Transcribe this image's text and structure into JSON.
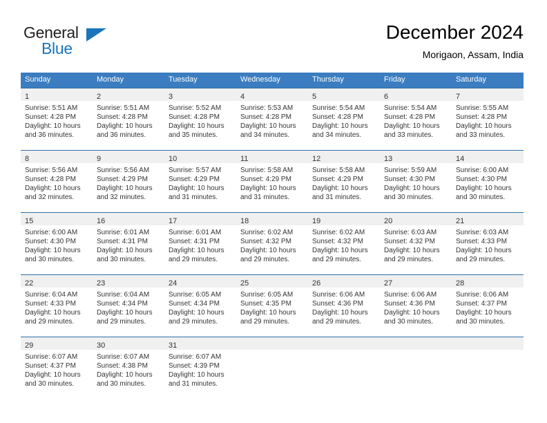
{
  "brand": {
    "name_top": "General",
    "name_bottom": "Blue",
    "color_dark": "#231f20",
    "color_blue": "#1b75bb"
  },
  "header": {
    "title": "December 2024",
    "subtitle": "Morigaon, Assam, India"
  },
  "theme": {
    "header_row_bg": "#3b7dc0",
    "header_row_text": "#ffffff",
    "daynum_band_bg": "#f0f0f0",
    "row_rule": "#2e6da4",
    "body_text": "#333333"
  },
  "calendar": {
    "weekday_headers": [
      "Sunday",
      "Monday",
      "Tuesday",
      "Wednesday",
      "Thursday",
      "Friday",
      "Saturday"
    ],
    "weeks": [
      [
        {
          "day": "1",
          "sunrise": "Sunrise: 5:51 AM",
          "sunset": "Sunset: 4:28 PM",
          "daylight_line1": "Daylight: 10 hours",
          "daylight_line2": "and 36 minutes."
        },
        {
          "day": "2",
          "sunrise": "Sunrise: 5:51 AM",
          "sunset": "Sunset: 4:28 PM",
          "daylight_line1": "Daylight: 10 hours",
          "daylight_line2": "and 36 minutes."
        },
        {
          "day": "3",
          "sunrise": "Sunrise: 5:52 AM",
          "sunset": "Sunset: 4:28 PM",
          "daylight_line1": "Daylight: 10 hours",
          "daylight_line2": "and 35 minutes."
        },
        {
          "day": "4",
          "sunrise": "Sunrise: 5:53 AM",
          "sunset": "Sunset: 4:28 PM",
          "daylight_line1": "Daylight: 10 hours",
          "daylight_line2": "and 34 minutes."
        },
        {
          "day": "5",
          "sunrise": "Sunrise: 5:54 AM",
          "sunset": "Sunset: 4:28 PM",
          "daylight_line1": "Daylight: 10 hours",
          "daylight_line2": "and 34 minutes."
        },
        {
          "day": "6",
          "sunrise": "Sunrise: 5:54 AM",
          "sunset": "Sunset: 4:28 PM",
          "daylight_line1": "Daylight: 10 hours",
          "daylight_line2": "and 33 minutes."
        },
        {
          "day": "7",
          "sunrise": "Sunrise: 5:55 AM",
          "sunset": "Sunset: 4:28 PM",
          "daylight_line1": "Daylight: 10 hours",
          "daylight_line2": "and 33 minutes."
        }
      ],
      [
        {
          "day": "8",
          "sunrise": "Sunrise: 5:56 AM",
          "sunset": "Sunset: 4:28 PM",
          "daylight_line1": "Daylight: 10 hours",
          "daylight_line2": "and 32 minutes."
        },
        {
          "day": "9",
          "sunrise": "Sunrise: 5:56 AM",
          "sunset": "Sunset: 4:29 PM",
          "daylight_line1": "Daylight: 10 hours",
          "daylight_line2": "and 32 minutes."
        },
        {
          "day": "10",
          "sunrise": "Sunrise: 5:57 AM",
          "sunset": "Sunset: 4:29 PM",
          "daylight_line1": "Daylight: 10 hours",
          "daylight_line2": "and 31 minutes."
        },
        {
          "day": "11",
          "sunrise": "Sunrise: 5:58 AM",
          "sunset": "Sunset: 4:29 PM",
          "daylight_line1": "Daylight: 10 hours",
          "daylight_line2": "and 31 minutes."
        },
        {
          "day": "12",
          "sunrise": "Sunrise: 5:58 AM",
          "sunset": "Sunset: 4:29 PM",
          "daylight_line1": "Daylight: 10 hours",
          "daylight_line2": "and 31 minutes."
        },
        {
          "day": "13",
          "sunrise": "Sunrise: 5:59 AM",
          "sunset": "Sunset: 4:30 PM",
          "daylight_line1": "Daylight: 10 hours",
          "daylight_line2": "and 30 minutes."
        },
        {
          "day": "14",
          "sunrise": "Sunrise: 6:00 AM",
          "sunset": "Sunset: 4:30 PM",
          "daylight_line1": "Daylight: 10 hours",
          "daylight_line2": "and 30 minutes."
        }
      ],
      [
        {
          "day": "15",
          "sunrise": "Sunrise: 6:00 AM",
          "sunset": "Sunset: 4:30 PM",
          "daylight_line1": "Daylight: 10 hours",
          "daylight_line2": "and 30 minutes."
        },
        {
          "day": "16",
          "sunrise": "Sunrise: 6:01 AM",
          "sunset": "Sunset: 4:31 PM",
          "daylight_line1": "Daylight: 10 hours",
          "daylight_line2": "and 30 minutes."
        },
        {
          "day": "17",
          "sunrise": "Sunrise: 6:01 AM",
          "sunset": "Sunset: 4:31 PM",
          "daylight_line1": "Daylight: 10 hours",
          "daylight_line2": "and 29 minutes."
        },
        {
          "day": "18",
          "sunrise": "Sunrise: 6:02 AM",
          "sunset": "Sunset: 4:32 PM",
          "daylight_line1": "Daylight: 10 hours",
          "daylight_line2": "and 29 minutes."
        },
        {
          "day": "19",
          "sunrise": "Sunrise: 6:02 AM",
          "sunset": "Sunset: 4:32 PM",
          "daylight_line1": "Daylight: 10 hours",
          "daylight_line2": "and 29 minutes."
        },
        {
          "day": "20",
          "sunrise": "Sunrise: 6:03 AM",
          "sunset": "Sunset: 4:32 PM",
          "daylight_line1": "Daylight: 10 hours",
          "daylight_line2": "and 29 minutes."
        },
        {
          "day": "21",
          "sunrise": "Sunrise: 6:03 AM",
          "sunset": "Sunset: 4:33 PM",
          "daylight_line1": "Daylight: 10 hours",
          "daylight_line2": "and 29 minutes."
        }
      ],
      [
        {
          "day": "22",
          "sunrise": "Sunrise: 6:04 AM",
          "sunset": "Sunset: 4:33 PM",
          "daylight_line1": "Daylight: 10 hours",
          "daylight_line2": "and 29 minutes."
        },
        {
          "day": "23",
          "sunrise": "Sunrise: 6:04 AM",
          "sunset": "Sunset: 4:34 PM",
          "daylight_line1": "Daylight: 10 hours",
          "daylight_line2": "and 29 minutes."
        },
        {
          "day": "24",
          "sunrise": "Sunrise: 6:05 AM",
          "sunset": "Sunset: 4:34 PM",
          "daylight_line1": "Daylight: 10 hours",
          "daylight_line2": "and 29 minutes."
        },
        {
          "day": "25",
          "sunrise": "Sunrise: 6:05 AM",
          "sunset": "Sunset: 4:35 PM",
          "daylight_line1": "Daylight: 10 hours",
          "daylight_line2": "and 29 minutes."
        },
        {
          "day": "26",
          "sunrise": "Sunrise: 6:06 AM",
          "sunset": "Sunset: 4:36 PM",
          "daylight_line1": "Daylight: 10 hours",
          "daylight_line2": "and 29 minutes."
        },
        {
          "day": "27",
          "sunrise": "Sunrise: 6:06 AM",
          "sunset": "Sunset: 4:36 PM",
          "daylight_line1": "Daylight: 10 hours",
          "daylight_line2": "and 30 minutes."
        },
        {
          "day": "28",
          "sunrise": "Sunrise: 6:06 AM",
          "sunset": "Sunset: 4:37 PM",
          "daylight_line1": "Daylight: 10 hours",
          "daylight_line2": "and 30 minutes."
        }
      ],
      [
        {
          "day": "29",
          "sunrise": "Sunrise: 6:07 AM",
          "sunset": "Sunset: 4:37 PM",
          "daylight_line1": "Daylight: 10 hours",
          "daylight_line2": "and 30 minutes."
        },
        {
          "day": "30",
          "sunrise": "Sunrise: 6:07 AM",
          "sunset": "Sunset: 4:38 PM",
          "daylight_line1": "Daylight: 10 hours",
          "daylight_line2": "and 30 minutes."
        },
        {
          "day": "31",
          "sunrise": "Sunrise: 6:07 AM",
          "sunset": "Sunset: 4:39 PM",
          "daylight_line1": "Daylight: 10 hours",
          "daylight_line2": "and 31 minutes."
        },
        {
          "day": "",
          "sunrise": "",
          "sunset": "",
          "daylight_line1": "",
          "daylight_line2": ""
        },
        {
          "day": "",
          "sunrise": "",
          "sunset": "",
          "daylight_line1": "",
          "daylight_line2": ""
        },
        {
          "day": "",
          "sunrise": "",
          "sunset": "",
          "daylight_line1": "",
          "daylight_line2": ""
        },
        {
          "day": "",
          "sunrise": "",
          "sunset": "",
          "daylight_line1": "",
          "daylight_line2": ""
        }
      ]
    ]
  }
}
